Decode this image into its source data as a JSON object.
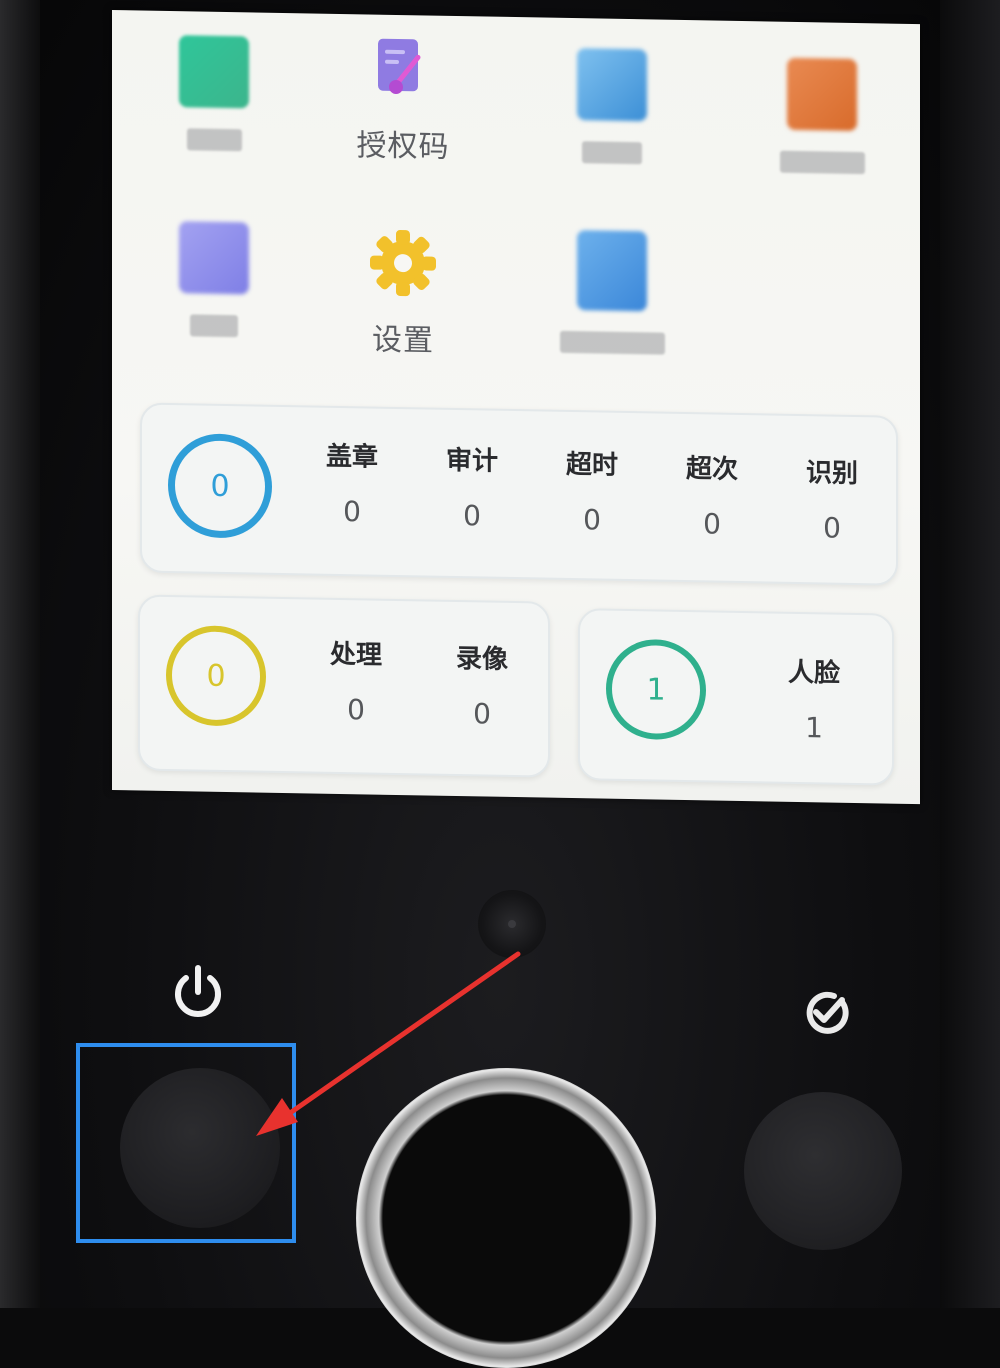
{
  "screen": {
    "apps_row1": [
      {
        "name": "blurred-app-1",
        "label": "",
        "icon": "green-app-icon"
      },
      {
        "name": "auth-code",
        "label": "授权码",
        "icon": "auth-code-icon"
      },
      {
        "name": "blurred-app-3",
        "label": "",
        "icon": "blue-app-icon"
      },
      {
        "name": "blurred-app-4",
        "label": "",
        "icon": "orange-app-icon"
      }
    ],
    "apps_row2": [
      {
        "name": "blurred-app-5",
        "label": "",
        "icon": "violet-app-icon"
      },
      {
        "name": "settings",
        "label": "设置",
        "icon": "gear-icon"
      },
      {
        "name": "blurred-app-7",
        "label": "",
        "icon": "blue-app-icon"
      }
    ],
    "stats_main": {
      "ring_value": "0",
      "items": [
        {
          "label": "盖章",
          "value": "0"
        },
        {
          "label": "审计",
          "value": "0"
        },
        {
          "label": "超时",
          "value": "0"
        },
        {
          "label": "超次",
          "value": "0"
        },
        {
          "label": "识别",
          "value": "0"
        }
      ],
      "color": "#2f9ed8"
    },
    "stats_left": {
      "ring_value": "0",
      "items": [
        {
          "label": "处理",
          "value": "0"
        },
        {
          "label": "录像",
          "value": "0"
        }
      ],
      "color": "#d8c52c"
    },
    "stats_right": {
      "ring_value": "1",
      "items": [
        {
          "label": "人脸",
          "value": "1"
        }
      ],
      "color": "#2fb08d"
    }
  },
  "hardware": {
    "power_icon": "power-icon",
    "confirm_icon": "check-circle-icon",
    "highlight_color": "#2e8dee",
    "arrow_color": "#e8322e"
  }
}
